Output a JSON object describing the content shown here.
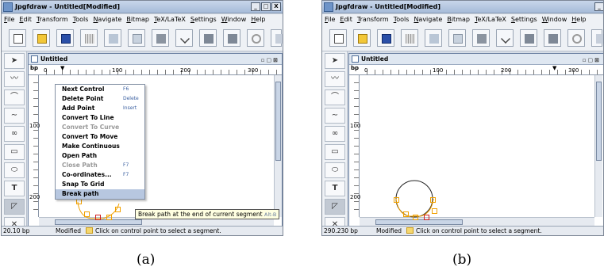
{
  "window": {
    "title_a": "Jpgfdraw - Untitled[Modified]",
    "title_b": "Jpgfdraw - Untitled[Modified]",
    "controls": [
      "_",
      "□",
      "X"
    ]
  },
  "menu": [
    "File",
    "Edit",
    "Transform",
    "Tools",
    "Navigate",
    "Bitmap",
    "TeX/LaTeX",
    "Settings",
    "Window",
    "Help"
  ],
  "toolbar_icons": [
    "new-icon",
    "open-folder-icon",
    "save-icon",
    "grid-icon",
    "image-icon",
    "table-icon",
    "book-icon",
    "check-curve-icon",
    "square-icon",
    "square-icon",
    "undo-icon",
    "redo-icon"
  ],
  "left_tools": [
    "select",
    "polyline",
    "open-curve",
    "curve",
    "loop",
    "rectangle",
    "ellipse",
    "T",
    "bitmap",
    "close"
  ],
  "inner": {
    "title": "Untitled",
    "unit": "bp",
    "ruler_h": [
      "0",
      "100",
      "200",
      "300"
    ],
    "ruler_v": [
      "100",
      "200"
    ]
  },
  "context_menu": [
    {
      "label": "Next Control",
      "shortcut": "F6",
      "disabled": false
    },
    {
      "label": "Delete Point",
      "shortcut": "Delete",
      "disabled": false
    },
    {
      "label": "Add Point",
      "shortcut": "Insert",
      "disabled": false
    },
    {
      "label": "Convert To Line",
      "shortcut": "",
      "disabled": false
    },
    {
      "label": "Convert To Curve",
      "shortcut": "",
      "disabled": true
    },
    {
      "label": "Convert To Move",
      "shortcut": "",
      "disabled": false
    },
    {
      "label": "Make Continuous",
      "shortcut": "",
      "disabled": false
    },
    {
      "label": "Open Path",
      "shortcut": "",
      "disabled": false
    },
    {
      "label": "Close Path",
      "shortcut": "F7",
      "disabled": true
    },
    {
      "label": "Co-ordinates...",
      "shortcut": "F7",
      "disabled": false
    },
    {
      "label": "Snap To Grid",
      "shortcut": "",
      "disabled": false
    },
    {
      "label": "Break path",
      "shortcut": "",
      "disabled": false,
      "selected": true
    }
  ],
  "tooltip": {
    "text": "Break path at the end of current segment",
    "shortcut": "Alt-B"
  },
  "status_a": {
    "coords": "20.10 bp",
    "mode": "Modified",
    "hint": "Click on control point to select a segment."
  },
  "status_b": {
    "coords": "290.230 bp",
    "mode": "Modified",
    "hint": "Click on control point to select a segment."
  },
  "captions": {
    "a": "(a)",
    "b": "(b)"
  },
  "colors": {
    "titlebar": "#a6bbd8",
    "accent": "#3b5f91",
    "control_point": "#f0a000",
    "selected_point": "#d02020"
  }
}
